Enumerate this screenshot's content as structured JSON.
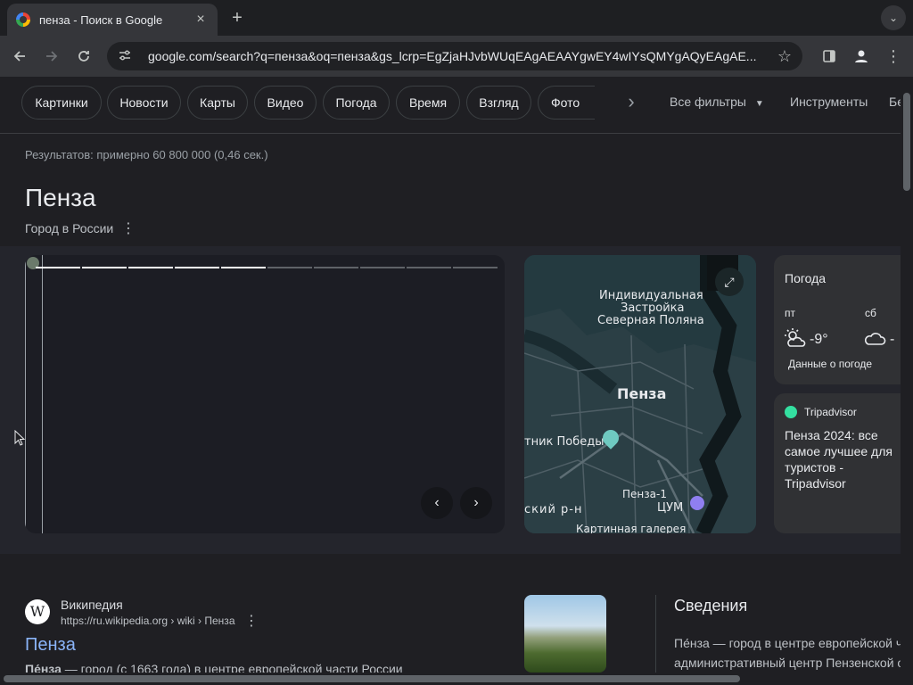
{
  "browser": {
    "tab_title": "пенза - Поиск в Google",
    "tab_close": "×",
    "new_tab": "+",
    "tab_menu": "⌄",
    "url": "google.com/search?q=пенза&oq=пенза&gs_lcrp=EgZjaHJvbWUqEAgAEAAYgwEY4wIYsQMYgAQyEAgAE...",
    "icons": {
      "back": "back-arrow-icon",
      "forward": "forward-arrow-icon",
      "reload": "reload-icon",
      "site_settings": "tune-icon",
      "bookmark": "star-icon",
      "side_panel": "side-panel-icon",
      "profile": "profile-icon",
      "menu": "kebab-menu-icon"
    }
  },
  "chips": [
    {
      "label": "Картинки"
    },
    {
      "label": "Новости"
    },
    {
      "label": "Карты"
    },
    {
      "label": "Видео"
    },
    {
      "label": "Погода"
    },
    {
      "label": "Время"
    },
    {
      "label": "Взгляд"
    },
    {
      "label": "Фото"
    }
  ],
  "filters": {
    "all_filters": "Все фильтры",
    "tools": "Инструменты",
    "more_partial": "Бе"
  },
  "result_stats": "Результатов: примерно 60 800 000 (0,46 сек.)",
  "knowledge_panel": {
    "title": "Пенза",
    "subtitle": "Город в России",
    "slideshow": {
      "segments_total": 10,
      "segments_done": 5
    },
    "map": {
      "labels": {
        "district_1": "Индивидуальная",
        "district_2": "Застройка",
        "district_3": "Северная Поляна",
        "city": "Пенза",
        "monument": "тник Победы",
        "station": "Пенза-1",
        "mall": "ЦУМ",
        "rayon": "ский р-н",
        "gallery": "Картинная галерея"
      }
    },
    "weather": {
      "title": "Погода",
      "day1": "пт",
      "temp1": "-9°",
      "day2": "сб",
      "temp2": "-",
      "link": "Данные о погоде"
    },
    "tripadvisor": {
      "source": "Tripadvisor",
      "text": "Пенза 2024: все самое лучшее для туристов - Tripadvisor"
    }
  },
  "result": {
    "site": "Википедия",
    "favicon": "W",
    "url": "https://ru.wikipedia.org › wiki › Пенза",
    "title": "Пенза",
    "snippet_bold": "Пе́нза",
    "snippet": " — город (с 1663 года) в центре европейской части России"
  },
  "info": {
    "title": "Сведения",
    "line1": "Пе́нза — город в центре европейской ч",
    "line2": "административный центр Пензенской о"
  },
  "colors": {
    "accent_link": "#8ab4f8",
    "progress_done": "#ffffff",
    "progress_todo": "#5f6368",
    "tripadvisor": "#34e0a1"
  }
}
